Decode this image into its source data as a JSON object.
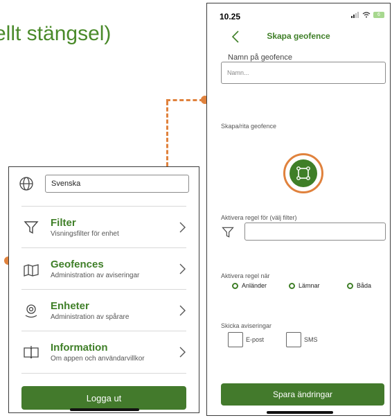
{
  "headline": "ellt stängsel)",
  "menu": {
    "language": "Svenska",
    "items": [
      {
        "title": "Filter",
        "subtitle": "Visningsfilter för enhet"
      },
      {
        "title": "Geofences",
        "subtitle": "Administration av aviseringar"
      },
      {
        "title": "Enheter",
        "subtitle": "Administration av spårare"
      },
      {
        "title": "Information",
        "subtitle": "Om appen och användarvillkor"
      }
    ],
    "logout": "Logga ut"
  },
  "phone": {
    "time": "10.25",
    "battery": "6",
    "title": "Skapa geofence",
    "name_label": "Namn på geofence",
    "name_placeholder": "Namn...",
    "draw_label": "Skapa/rita geofence",
    "filter_label": "Aktivera regel för (välj filter)",
    "when_label": "Aktivera regel när",
    "radios": [
      "Anländer",
      "Lämnar",
      "Båda"
    ],
    "notify_label": "Skicka aviseringar",
    "checks": [
      "E-post",
      "SMS"
    ],
    "save": "Spara ändringar"
  },
  "colors": {
    "accent": "#e0823d",
    "brand": "#3f7f28",
    "button": "#437a2c"
  }
}
